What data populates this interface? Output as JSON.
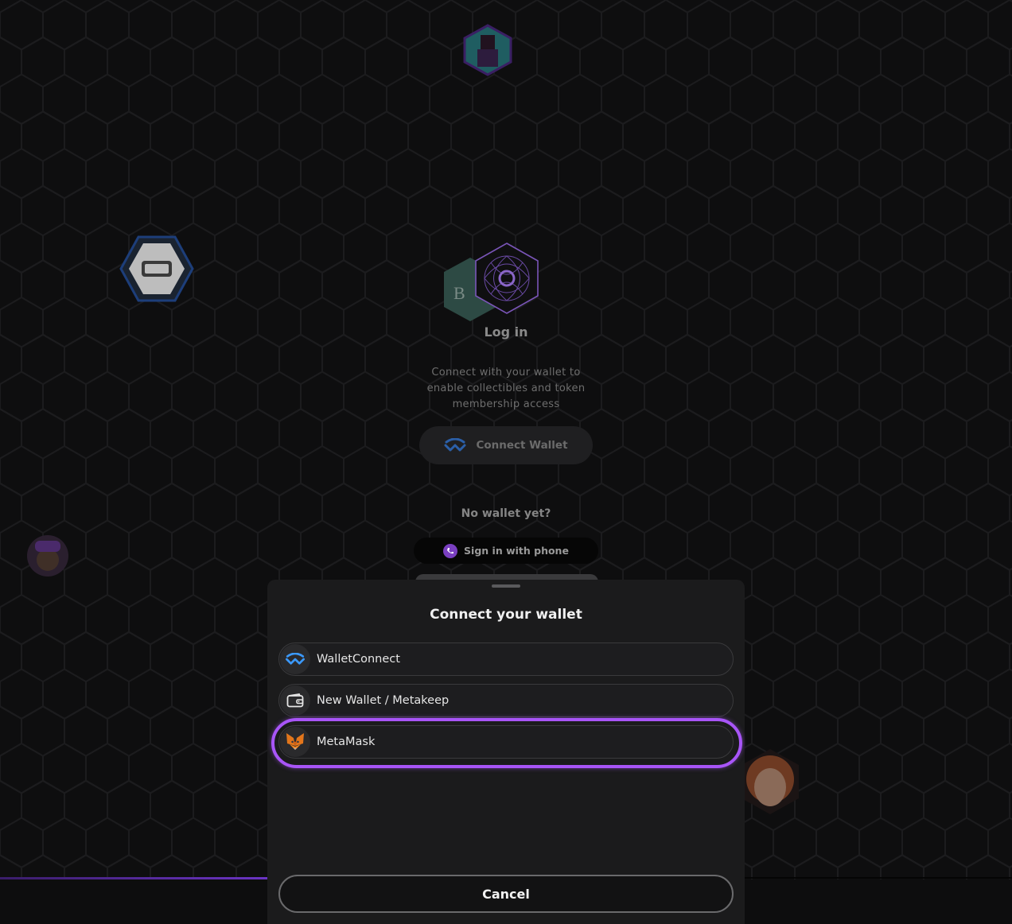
{
  "login": {
    "title": "Log in",
    "description": "Connect with your wallet to enable collectibles and token membership access",
    "connect_wallet_label": "Connect Wallet",
    "no_wallet_text": "No wallet yet?",
    "phone_signin_label": "Sign in with phone"
  },
  "modal": {
    "title": "Connect your wallet",
    "options": [
      {
        "label": "WalletConnect",
        "icon": "walletconnect-icon"
      },
      {
        "label": "New Wallet / Metakeep",
        "icon": "wallet-icon"
      },
      {
        "label": "MetaMask",
        "icon": "metamask-fox-icon"
      }
    ],
    "highlighted_option": "MetaMask",
    "cancel_label": "Cancel"
  },
  "colors": {
    "background": "#0e0e0f",
    "accent_purple": "#a855f7",
    "walletconnect_blue": "#3b99fc",
    "modal_bg": "#1b1b1c"
  }
}
